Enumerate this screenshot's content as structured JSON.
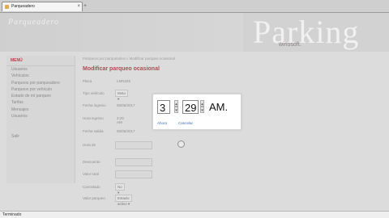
{
  "browser": {
    "tab_title": "Parqueadero",
    "close_glyph": "×",
    "new_tab_glyph": "+"
  },
  "header": {
    "site_title": "Parqueadero",
    "logo_text": "Parking",
    "logo_sub": "winosoft."
  },
  "sidebar": {
    "heading": "MENÚ",
    "items": [
      "Usuarios",
      "Vehículos",
      "Parqueos por parqueadero",
      "Parqueos por vehículo",
      "Estado de mi parqueo",
      "Tarifas",
      "Mensajes",
      "Usuarios",
      "",
      "",
      "Salir"
    ]
  },
  "content": {
    "breadcrumb": "Parqueos por parqueadero  /  Modificar parqueo ocasional",
    "heading": "Modificar parqueo ocasional",
    "rows": [
      {
        "label": "Placa",
        "value": "LMN325",
        "type": "text"
      },
      {
        "label": "Tipo vehículo",
        "value": "Moto",
        "type": "select"
      },
      {
        "label": "Fecha ingreso",
        "value": "05/05/2017",
        "type": "text"
      },
      {
        "label": "Hora ingreso",
        "value": "3:29 AM",
        "type": "time"
      },
      {
        "label": "Fecha salida",
        "value": "05/05/2017",
        "type": "text"
      },
      {
        "label": "Hora de",
        "value": "",
        "type": "input"
      },
      {
        "label": "Descuento",
        "value": "",
        "type": "input"
      },
      {
        "label": "Valor total",
        "value": "",
        "type": "input"
      },
      {
        "label": "Cancelado",
        "value": "No",
        "type": "select"
      },
      {
        "label": "Valor parqueo",
        "value": "Estado: activo",
        "type": "select"
      }
    ]
  },
  "time_picker": {
    "hour": "3",
    "minute": "29",
    "ampm": "AM.",
    "now_link": "Ahora",
    "cancel_link": "Cancelar",
    "up_glyph": "▴",
    "down_glyph": "▾"
  },
  "status_bar": {
    "text": "Terminado"
  }
}
